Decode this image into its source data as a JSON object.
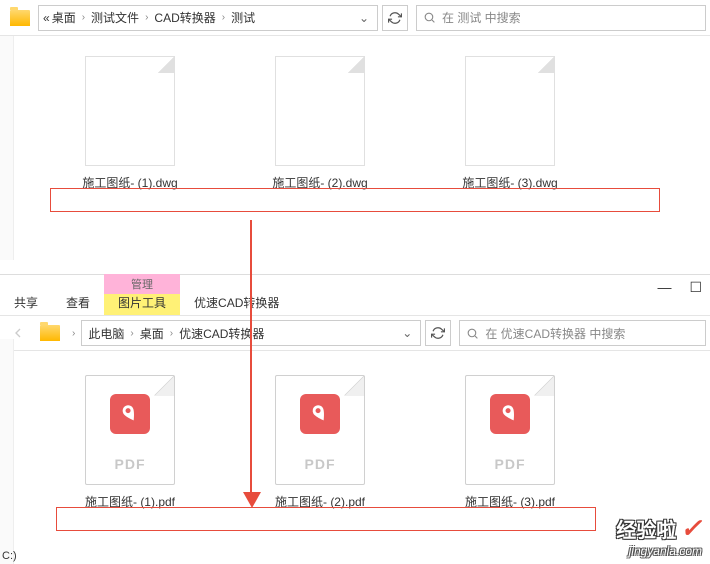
{
  "top_window": {
    "breadcrumb": [
      "桌面",
      "测试文件",
      "CAD转换器",
      "测试"
    ],
    "breadcrumb_prefix": "«",
    "search_placeholder": "在 测试 中搜索",
    "files": [
      {
        "name": "施工图纸- (1).dwg"
      },
      {
        "name": "施工图纸- (2).dwg"
      },
      {
        "name": "施工图纸- (3).dwg"
      }
    ]
  },
  "bottom_window": {
    "tabs": {
      "share": "共享",
      "view": "查看",
      "tools": "图片工具",
      "manage": "管理"
    },
    "title": "优速CAD转换器",
    "breadcrumb": [
      "此电脑",
      "桌面",
      "优速CAD转换器"
    ],
    "search_placeholder": "在 优速CAD转换器 中搜索",
    "files": [
      {
        "name": "施工图纸- (1).pdf"
      },
      {
        "name": "施工图纸- (2).pdf"
      },
      {
        "name": "施工图纸- (3).pdf"
      }
    ],
    "pdf_label": "PDF",
    "drive": "C:)"
  },
  "watermark": {
    "top": "经验啦",
    "url": "jingyanla.com"
  }
}
